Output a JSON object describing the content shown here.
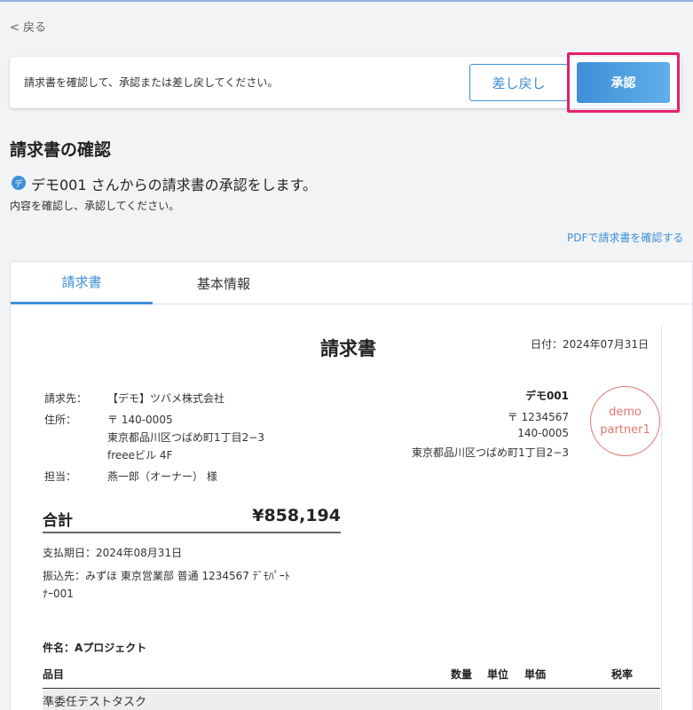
{
  "nav": {
    "back_label": "< 戻る"
  },
  "banner": {
    "message": "請求書を確認して、承認または差し戻してください。",
    "reject_label": "差し戻し",
    "approve_label": "承認"
  },
  "header": {
    "page_title": "請求書の確認",
    "avatar_letter": "デ",
    "request_line": "デモ001 さんからの請求書の承認をします。",
    "instruction": "内容を確認し、承認してください。",
    "pdf_link": "PDFで請求書を確認する"
  },
  "tabs": [
    {
      "label": "請求書",
      "active": true
    },
    {
      "label": "基本情報",
      "active": false
    }
  ],
  "invoice": {
    "title": "請求書",
    "date": "日付：2024年07月31日",
    "billing_to_label": "請求先：",
    "billing_to": "【デモ】ツバメ株式会社",
    "address_label": "住所：",
    "address_lines": [
      "〒 140-0005",
      "東京都品川区つばめ町1丁目2−3",
      "freeeビル 4F"
    ],
    "contact_label": "担当：",
    "contact": "燕一郎（オーナー） 様",
    "sender": {
      "name": "デモ001",
      "postal": "〒 1234567",
      "address1": "140-0005",
      "address2": "東京都品川区つばめ町1丁目2−3"
    },
    "stamp": {
      "line1": "demo",
      "line2": "partner1"
    },
    "total_label": "合計",
    "total_value": "¥858,194",
    "payment_due": "支払期日：2024年08月31日",
    "bank_line1": "振込先：みずほ 東京営業部 普通 1234567 ﾃﾞﾓﾊﾟｰﾄ",
    "bank_line2": "ﾅｰ001",
    "subject": "件名：Aプロジェクト",
    "table_headers": {
      "item": "品目",
      "qty": "数量",
      "unit": "単位",
      "price": "単価",
      "tax": "税率"
    },
    "rows": [
      {
        "item": "準委任テストタスク"
      }
    ]
  }
}
